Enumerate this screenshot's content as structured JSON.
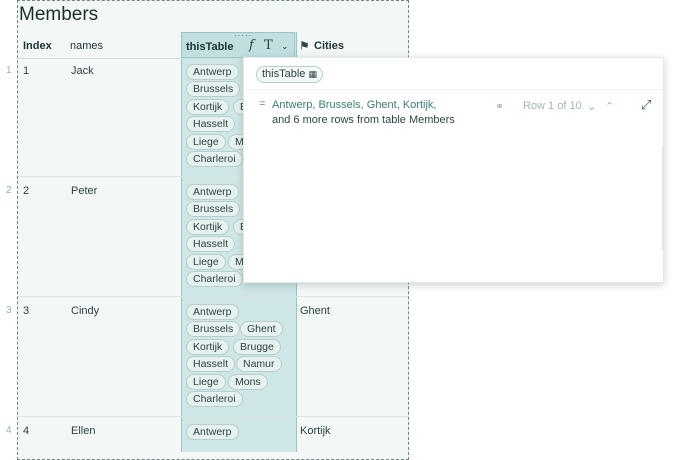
{
  "table": {
    "title": "Members",
    "headers": {
      "index": "Index",
      "names": "names",
      "this_table": "thisTable",
      "cities": "Cities"
    },
    "rows": [
      {
        "num": "1",
        "index": "1",
        "name": "Jack",
        "chips": [
          "Antwerp",
          "Brussels",
          "G",
          "Kortijk",
          "B",
          "Hasselt",
          "",
          "Liege",
          "M",
          "Charleroi"
        ],
        "city": ""
      },
      {
        "num": "2",
        "index": "2",
        "name": "Peter",
        "chips": [
          "Antwerp",
          "Brussels",
          "",
          "Kortijk",
          "B",
          "Hasselt",
          "",
          "Liege",
          "M",
          "Charleroi"
        ],
        "city": ""
      },
      {
        "num": "3",
        "index": "3",
        "name": "Cindy",
        "chips": [
          "Antwerp",
          "Brussels",
          "Ghent",
          "Kortijk",
          "Brugge",
          "Hasselt",
          "Namur",
          "Liege",
          "Mons",
          "Charleroi"
        ],
        "city": "Ghent"
      },
      {
        "num": "4",
        "index": "4",
        "name": "Ellen",
        "chips": [
          "Antwerp"
        ],
        "city": "Kortijk"
      }
    ]
  },
  "icons": {
    "formula": "function-icon",
    "type": "text-type-icon",
    "menu": "chevron-down-icon",
    "bookmark": "bookmark-icon"
  },
  "popup": {
    "tag": "thisTable",
    "line1": "Antwerp, Brussels, Ghent, Kortijk,",
    "line2": "and 6 more rows from table Members",
    "row_label": "Row 1 of 10"
  }
}
